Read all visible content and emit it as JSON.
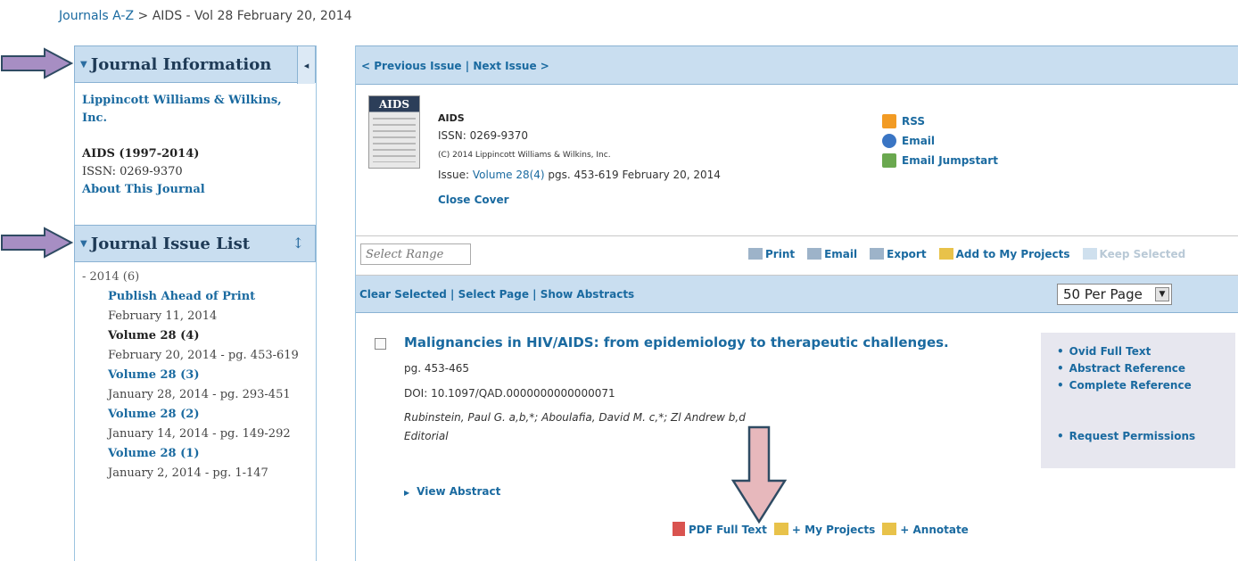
{
  "breadcrumb": {
    "link": "Journals A-Z",
    "separator": " > ",
    "current": "AIDS - Vol 28 February 20, 2014"
  },
  "journal_info": {
    "heading": "Journal Information",
    "publisher": "Lippincott Williams & Wilkins, Inc.",
    "title_years": "AIDS (1997-2014)",
    "issn": "ISSN: 0269-9370",
    "about": "About This Journal"
  },
  "issue_list": {
    "heading": "Journal Issue List",
    "year": "- 2014 (6)",
    "items": [
      {
        "label": "Publish Ahead of Print",
        "date": "February 11, 2014"
      },
      {
        "label": "Volume 28 (4)",
        "date": "February 20, 2014 - pg. 453-619"
      },
      {
        "label": "Volume 28 (3)",
        "date": "January 28, 2014 - pg. 293-451"
      },
      {
        "label": "Volume 28 (2)",
        "date": "January 14, 2014 - pg. 149-292"
      },
      {
        "label": "Volume 28 (1)",
        "date": "January 2, 2014 - pg. 1-147"
      }
    ]
  },
  "issue_nav": {
    "prev": "< Previous Issue",
    "sep": " | ",
    "next": "Next Issue >"
  },
  "cover": {
    "cover_text": "AIDS",
    "journal": "AIDS",
    "issn": "ISSN: 0269-9370",
    "copyright": "(C) 2014 Lippincott Williams & Wilkins, Inc.",
    "issue_prefix": "Issue: ",
    "issue_volume": "Volume 28(4)",
    "issue_rest": " pgs. 453-619 February 20, 2014",
    "close": "Close Cover",
    "rss": "RSS",
    "email": "Email",
    "email_jumpstart": "Email Jumpstart"
  },
  "toolbar": {
    "range_placeholder": "Select Range",
    "print": "Print",
    "email": "Email",
    "export": "Export",
    "add_projects": "Add to My Projects",
    "keep_selected": "Keep Selected"
  },
  "selection": {
    "clear": "Clear Selected",
    "sep": " | ",
    "select_page": "Select Page",
    "show_abstracts": "Show Abstracts",
    "per_page": "50  Per Page"
  },
  "result": {
    "title": "Malignancies in HIV/AIDS: from epidemiology to therapeutic challenges.",
    "pages": "pg. 453-465",
    "doi": "DOI: 10.1097/QAD.0000000000000071",
    "authors": "Rubinstein, Paul G. a,b,*; Aboulafia, David M. c,*; Zl       Andrew b,d",
    "type": "Editorial",
    "view_abstract": "View Abstract",
    "pdf": "PDF Full Text",
    "my_projects": "+ My Projects",
    "annotate": "+ Annotate",
    "links": [
      "Ovid Full Text",
      "Abstract Reference",
      "Complete Reference",
      "Request Permissions"
    ]
  },
  "colors": {
    "arrow_purple": "#a78ec3",
    "arrow_pink": "#e7b8bc",
    "arrow_border": "#2f4b63",
    "header_bg": "#c9def0"
  }
}
